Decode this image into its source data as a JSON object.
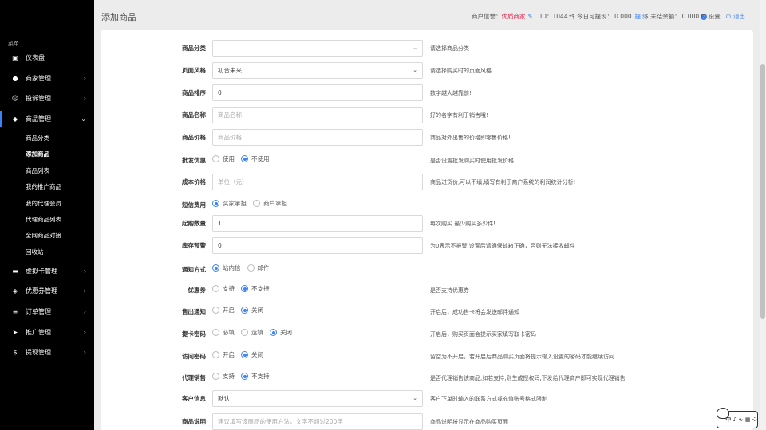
{
  "sidebar": {
    "menu_title": "菜单",
    "items": [
      {
        "label": "仪表盘",
        "icon": "dashboard-icon",
        "glyph": "▣",
        "chev": ""
      },
      {
        "label": "商家管理",
        "icon": "user-icon",
        "glyph": "●",
        "chev": "›"
      },
      {
        "label": "投诉管理",
        "icon": "complaint-icon",
        "glyph": "☹",
        "chev": "›"
      },
      {
        "label": "商品管理",
        "icon": "shopping-bag-icon",
        "glyph": "◆",
        "chev": "⌄"
      },
      {
        "label": "虚拟卡管理",
        "icon": "card-icon",
        "glyph": "▬",
        "chev": "›"
      },
      {
        "label": "优惠券管理",
        "icon": "tag-icon",
        "glyph": "◈",
        "chev": "›"
      },
      {
        "label": "订单管理",
        "icon": "list-icon",
        "glyph": "≡",
        "chev": "›"
      },
      {
        "label": "推广管理",
        "icon": "send-icon",
        "glyph": "➤",
        "chev": "›"
      },
      {
        "label": "提现管理",
        "icon": "dollar-icon",
        "glyph": "$",
        "chev": "›"
      }
    ],
    "sub_items": [
      "商品分类",
      "添加商品",
      "商品列表",
      "我的推广商品",
      "我的代理会员",
      "代理商品列表",
      "全网商品对接",
      "回收站"
    ]
  },
  "header": {
    "title": "添加商品",
    "credit_label": "商户信誉：",
    "credit_value": "优质商家",
    "id_label": "ID：",
    "id_value": "10443",
    "withdrawable_label": "$ 今日可提现：",
    "withdrawable_value": "0.000",
    "withdraw_link": "提现",
    "unsettled_label": "$ 未结余额：",
    "unsettled_value": "0.000",
    "settings": "设置",
    "logout": "退出"
  },
  "form": {
    "category": {
      "label": "商品分类",
      "value": "",
      "hint": "请选择商品分类"
    },
    "style": {
      "label": "页面风格",
      "value": "初音未来",
      "hint": "请选择购买时的页面风格"
    },
    "sort": {
      "label": "商品排序",
      "value": "0",
      "hint": "数字越大越靠前!"
    },
    "name": {
      "label": "商品名称",
      "placeholder": "商品名称",
      "hint": "好的名字有利于销售哦!"
    },
    "price": {
      "label": "商品价格",
      "placeholder": "商品价格",
      "hint": "商品对外出售的价格即零售价格!"
    },
    "wholesale": {
      "label": "批发优惠",
      "options": [
        "使用",
        "不使用"
      ],
      "hint": "是否设置批发购买时使用批发价格!"
    },
    "cost": {
      "label": "成本价格",
      "placeholder": "单位（元）",
      "hint": "商品进货价,可以不填,填写有利于商户系统的利润统计分析!"
    },
    "sms_fee": {
      "label": "短信费用",
      "options": [
        "买家承担",
        "商户承担"
      ],
      "hint": ""
    },
    "min_qty": {
      "label": "起购数量",
      "value": "1",
      "hint": "每次购买 最少购买多少件!"
    },
    "stock_alert": {
      "label": "库存预警",
      "value": "0",
      "hint": "为0表示不报警,设置后请确保邮箱正确，否则无法接收邮件"
    },
    "notify": {
      "label": "通知方式",
      "options": [
        "站内信",
        "邮件"
      ],
      "hint": ""
    },
    "coupon": {
      "label": "优惠券",
      "options": [
        "支持",
        "不支持"
      ],
      "hint": "是否支持优惠券"
    },
    "sold_notify": {
      "label": "售出通知",
      "options": [
        "开启",
        "关闭"
      ],
      "hint": "开启后，成功售卡将会发送邮件通知"
    },
    "pickup_pwd": {
      "label": "提卡密码",
      "options": [
        "必填",
        "选填",
        "关闭"
      ],
      "hint": "开启后，购买页面会提示买家填写取卡密码"
    },
    "visit_pwd": {
      "label": "访问密码",
      "options": [
        "开启",
        "关闭"
      ],
      "hint": "留空为不开启，若开启后商品购买页面将提示输入设置的密码才能继续访问"
    },
    "agent_sale": {
      "label": "代理销售",
      "options": [
        "支持",
        "不支持"
      ],
      "hint": "是否代理销售该商品,如若支持,则生成授权码,下发给代理商户即可实现代理销售"
    },
    "customer_info": {
      "label": "客户信息",
      "value": "默认",
      "hint": "客户下单时输入的联系方式或充值账号格式限制"
    },
    "description": {
      "label": "商品说明",
      "placeholder": "建议填写该商品的使用方法，文字不超过200字",
      "hint": "商品说明将显示在商品购买页面"
    }
  },
  "widget": {
    "text": "中 ♪ ∿ ▦ ⁘"
  },
  "colors": {
    "sidebar_bg": "#000000",
    "accent": "#3b82f6",
    "danger": "#e11d48"
  }
}
